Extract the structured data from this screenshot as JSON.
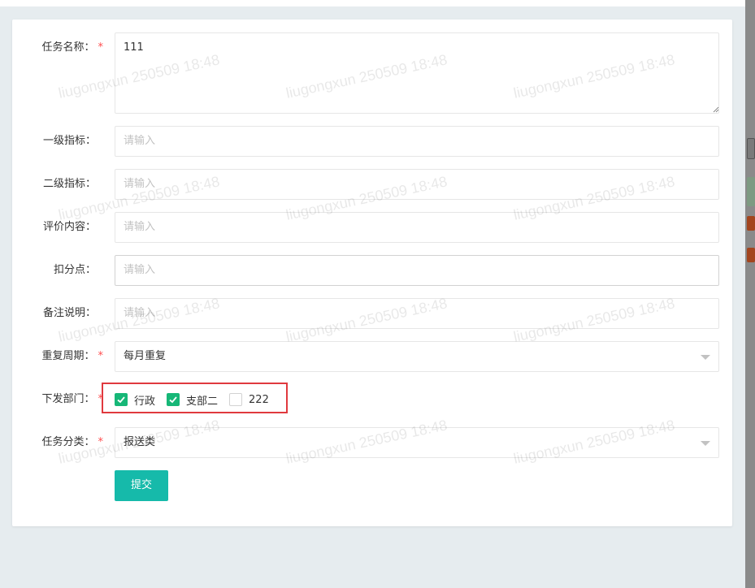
{
  "form": {
    "task_name": {
      "label": "任务名称：",
      "required_mark": "*",
      "value": "111"
    },
    "level1": {
      "label": "一级指标：",
      "placeholder": "请输入"
    },
    "level2": {
      "label": "二级指标：",
      "placeholder": "请输入"
    },
    "evaluation": {
      "label": "评价内容：",
      "placeholder": "请输入"
    },
    "deduction": {
      "label": "扣分点：",
      "placeholder": "请输入"
    },
    "remark": {
      "label": "备注说明：",
      "placeholder": "请输入"
    },
    "cycle": {
      "label": "重复周期：",
      "required_mark": "*",
      "value": "每月重复"
    },
    "departments": {
      "label": "下发部门：",
      "required_mark": "*",
      "options": [
        {
          "label": "行政",
          "checked": true
        },
        {
          "label": "支部二",
          "checked": true
        },
        {
          "label": "222",
          "checked": false
        }
      ]
    },
    "category": {
      "label": "任务分类：",
      "required_mark": "*",
      "value": "报送类"
    },
    "submit_label": "提交"
  },
  "watermark": {
    "text": "liugongxun 250509 18:48"
  },
  "colors": {
    "primary": "#16baaa",
    "checked": "#16b777",
    "required": "#ff4d4f",
    "highlight": "#e0393e"
  }
}
